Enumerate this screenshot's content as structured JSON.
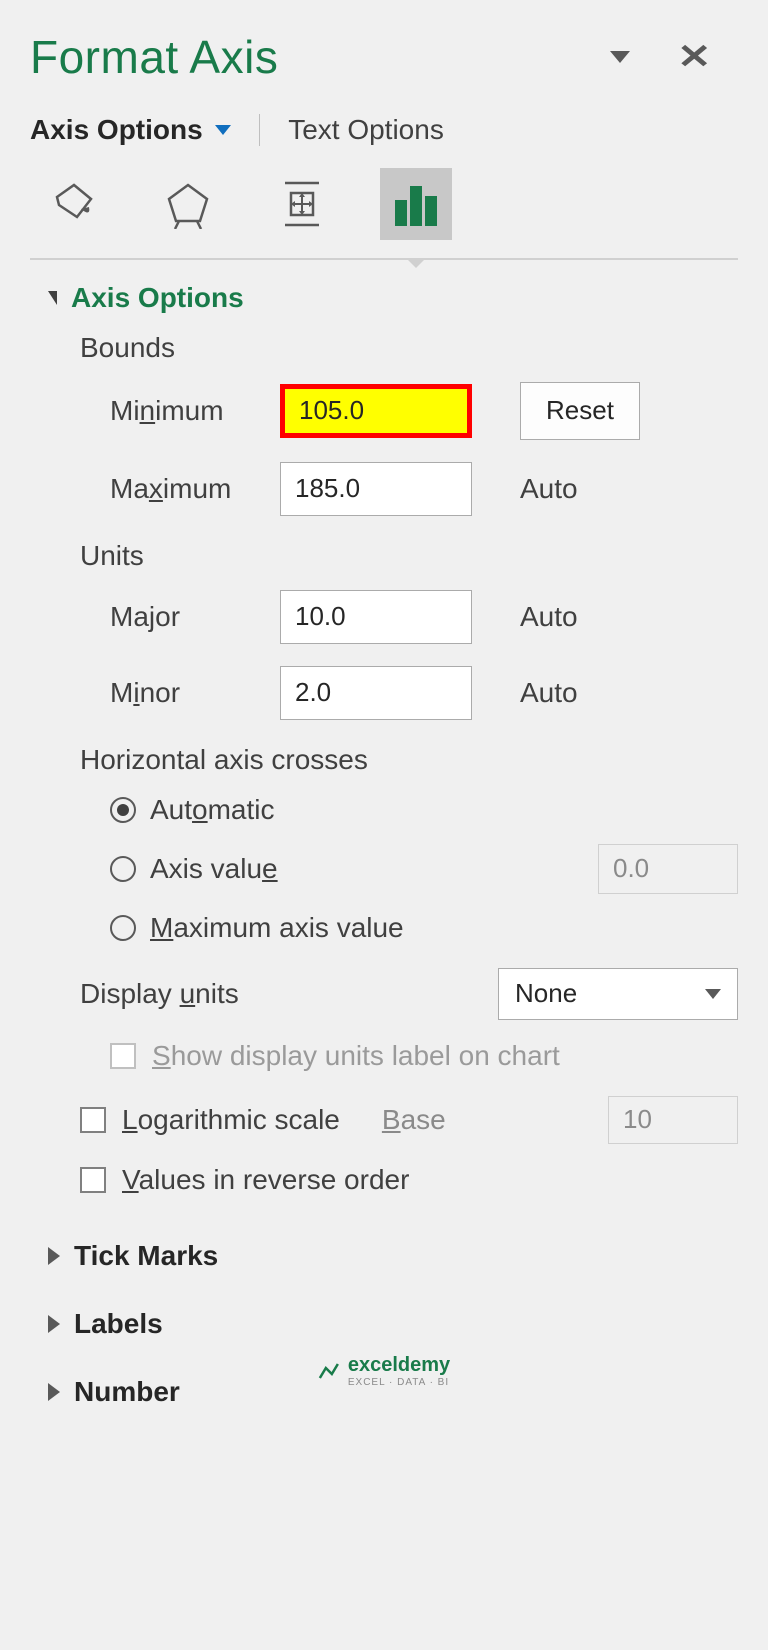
{
  "pane": {
    "title": "Format Axis",
    "tabs": {
      "axis_options": "Axis Options",
      "text_options": "Text Options"
    }
  },
  "sections": {
    "axis_options": {
      "title": "Axis Options",
      "bounds": {
        "label": "Bounds",
        "minimum_label": "Minimum",
        "minimum_value": "105.0",
        "minimum_aux": "Reset",
        "maximum_label": "Maximum",
        "maximum_value": "185.0",
        "maximum_aux": "Auto"
      },
      "units": {
        "label": "Units",
        "major_label": "Major",
        "major_value": "10.0",
        "major_aux": "Auto",
        "minor_label": "Minor",
        "minor_value": "2.0",
        "minor_aux": "Auto"
      },
      "crosses": {
        "label": "Horizontal axis crosses",
        "automatic": "Automatic",
        "axis_value": "Axis value",
        "axis_value_input": "0.0",
        "max_value": "Maximum axis value"
      },
      "display_units": {
        "label": "Display units",
        "selected": "None",
        "show_label": "Show display units label on chart"
      },
      "log_scale": {
        "label": "Logarithmic scale",
        "base_label": "Base",
        "base_value": "10"
      },
      "reverse": {
        "label": "Values in reverse order"
      }
    },
    "tick_marks": "Tick Marks",
    "labels": "Labels",
    "number": "Number"
  },
  "watermark": {
    "brand": "exceldemy",
    "tagline": "EXCEL · DATA · BI"
  }
}
